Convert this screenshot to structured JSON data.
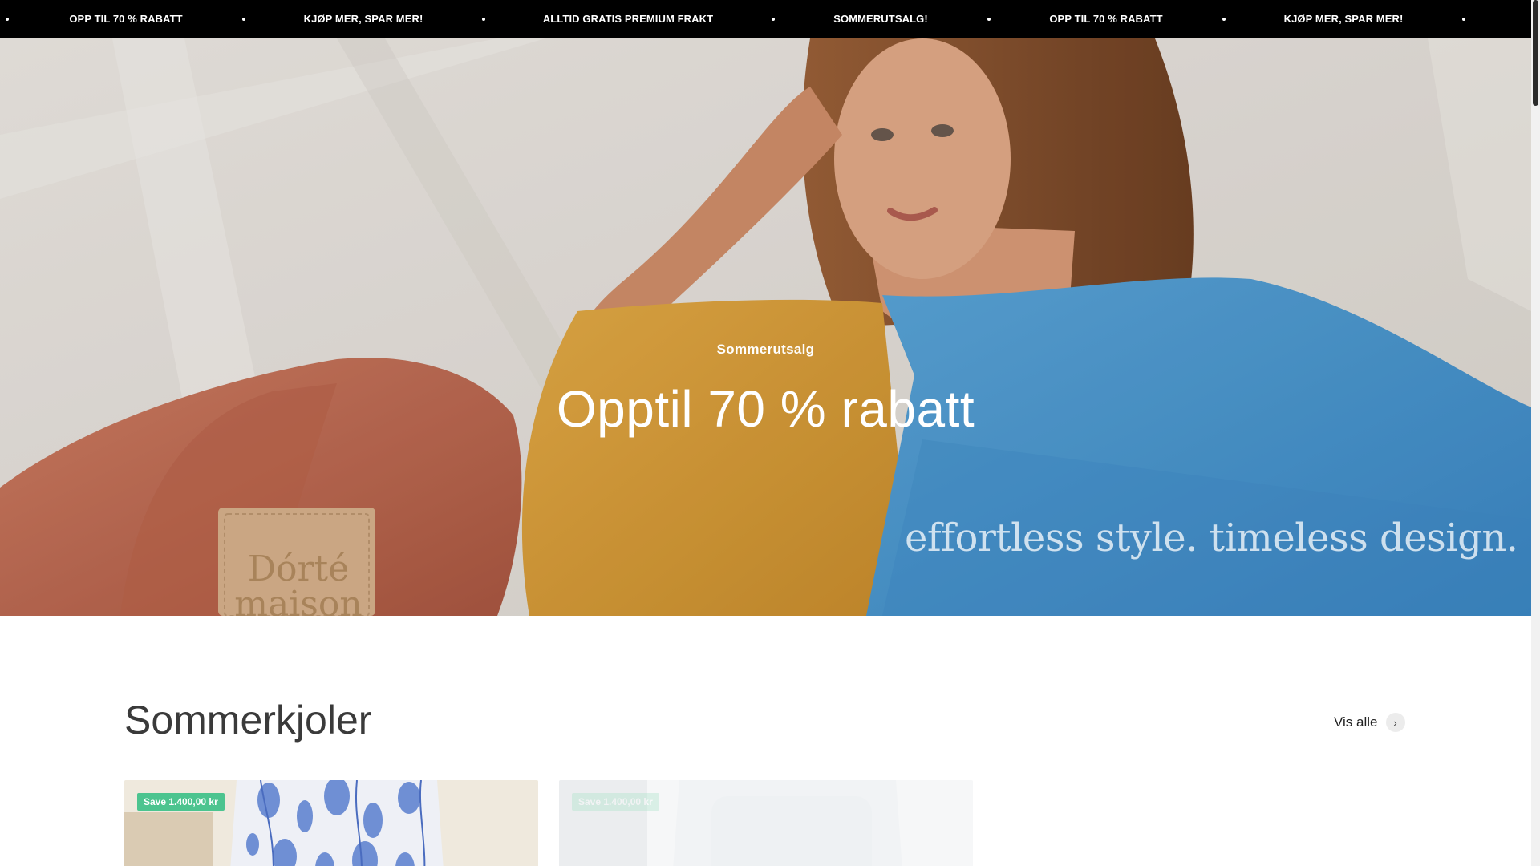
{
  "announcement": {
    "items": [
      "OPP TIL 70 % RABATT",
      "KJØP MER, SPAR MER!",
      "ALLTID GRATIS PREMIUM FRAKT",
      "SOMMERUTSALG!",
      "OPP TIL 70 % RABATT",
      "KJØP MER, SPAR MER!"
    ]
  },
  "hero": {
    "subheading": "Sommerutsalg",
    "heading": "Opptil 70 % rabatt",
    "image_overlay_text": "effortless style. timeless design.",
    "patch_text": "Dórté maison"
  },
  "section": {
    "title": "Sommerkjoler",
    "view_all_label": "Vis alle",
    "view_all_icon": "chevron-right-icon"
  },
  "products": [
    {
      "badge": "Save 1.400,00 kr"
    },
    {
      "badge": "Save 1.400,00 kr"
    }
  ],
  "colors": {
    "announcement_bg": "#000000",
    "badge_bg": "#4cc48f",
    "page_bg": "#ffffff"
  }
}
